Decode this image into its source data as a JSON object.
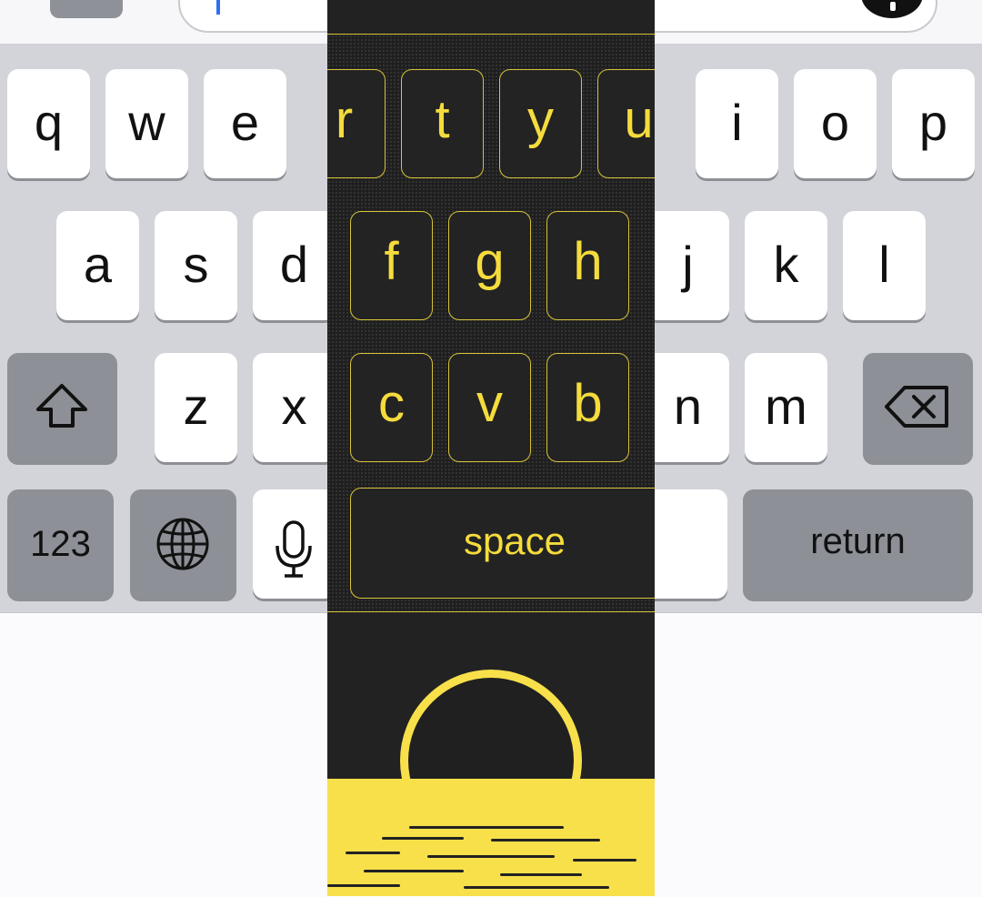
{
  "keyboard": {
    "row1": [
      "q",
      "w",
      "e",
      "r",
      "t",
      "y",
      "u",
      "i",
      "o",
      "p"
    ],
    "row2": [
      "a",
      "s",
      "d",
      "f",
      "g",
      "h",
      "j",
      "k",
      "l"
    ],
    "row3": [
      "z",
      "x",
      "c",
      "v",
      "b",
      "n",
      "m"
    ],
    "numbers_label": "123",
    "space_label": "space",
    "return_label": "return"
  },
  "icons": {
    "shift": "shift-arrow-icon",
    "delete": "backspace-icon",
    "globe": "globe-icon",
    "mic": "microphone-icon",
    "info": "info-icon"
  },
  "colors": {
    "keyboard_bg": "#d3d4d9",
    "key_bg": "#ffffff",
    "special_key_bg": "#8d9096",
    "overlay_bg": "#222222",
    "overlay_accent": "#f5dc3c",
    "text_caret": "#2f6ef5"
  }
}
